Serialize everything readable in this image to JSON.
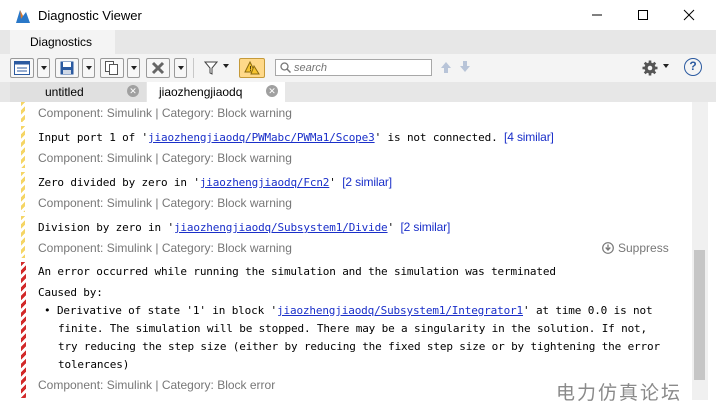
{
  "window": {
    "title": "Diagnostic Viewer"
  },
  "ribbon": {
    "tab_label": "Diagnostics"
  },
  "search": {
    "placeholder": "search"
  },
  "tabs": [
    {
      "label": "untitled"
    },
    {
      "label": "jiaozhengjiaodq"
    }
  ],
  "messages": {
    "m0": {
      "meta": "Component: Simulink | Category: Block warning"
    },
    "m1": {
      "pre": "Input port 1 of '",
      "link": "jiaozhengjiaodq/PWMabc/PWMa1/Scope3",
      "post": "' is not connected. ",
      "similar": "[4 similar]",
      "meta": "Component: Simulink | Category: Block warning"
    },
    "m2": {
      "pre": "Zero divided by zero in '",
      "link": "jiaozhengjiaodq/Fcn2",
      "post": "' ",
      "similar": "[2 similar]",
      "meta": "Component: Simulink | Category: Block warning"
    },
    "m3": {
      "pre": "Division by zero in '",
      "link": "jiaozhengjiaodq/Subsystem1/Divide",
      "post": "' ",
      "similar": "[2 similar]",
      "meta": "Component: Simulink | Category: Block warning",
      "suppress": "Suppress"
    },
    "error": {
      "headline": "An error occurred while running the simulation and the simulation was terminated",
      "caused_by": "Caused by:",
      "bullet_pre": "Derivative of state '1' in block '",
      "bullet_link": "jiaozhengjiaodq/Subsystem1/Integrator1",
      "bullet_post": "' at time 0.0 is not",
      "line2": "finite. The simulation will be stopped. There may be a singularity in the solution.  If not,",
      "line3": "try reducing the step size (either by reducing the fixed step size or by tightening the error",
      "line4": "tolerances)",
      "meta": "Component: Simulink | Category: Block error"
    }
  },
  "watermark": "电力仿真论坛",
  "icons": {
    "app": "simulink-icon",
    "minimize": "minimize-icon",
    "maximize": "maximize-icon",
    "close": "close-icon",
    "settings": "gear-icon",
    "help": "help-icon",
    "filter": "filter-icon",
    "warning_filter": "warning-filter-icon"
  },
  "colors": {
    "link": "#1a2fc9",
    "warning": "#f5d565",
    "error": "#d22a2a",
    "active_toggle": "#ffd98a"
  }
}
